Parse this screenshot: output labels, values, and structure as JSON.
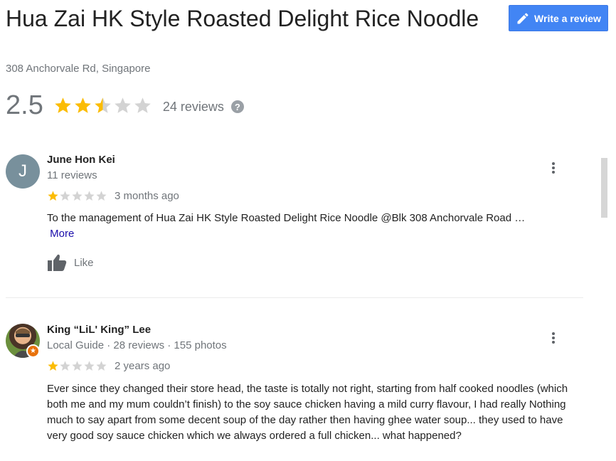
{
  "place": {
    "name": "Hua Zai HK Style Roasted Delight Rice Noodle",
    "address": "308 Anchorvale Rd, Singapore",
    "rating": "2.5",
    "rating_value": 2.5,
    "review_count": "24 reviews",
    "help_icon": "?"
  },
  "actions": {
    "write_review": "Write a review",
    "write_icon": "pencil-icon"
  },
  "colors": {
    "star_filled": "#fbbc04",
    "star_empty": "#d3d3d3",
    "accent": "#4285f4",
    "link": "#1a0dab"
  },
  "reviews": [
    {
      "avatar_letter": "J",
      "author": "June Hon Kei",
      "meta": "11 reviews",
      "stars": 1,
      "time": "3 months ago",
      "text": "To the management of Hua Zai HK Style Roasted Delight Rice Noodle @Blk 308 Anchorvale Road …",
      "more": "More",
      "like": "Like"
    },
    {
      "author": "King “LiL' King” Lee",
      "meta": "Local Guide · 28 reviews · 155 photos",
      "stars": 1,
      "time": "2 years ago",
      "text": "Ever since they changed their store head, the taste is totally not right, starting from half cooked noodles (which both me and my mum couldn’t finish) to the soy sauce chicken having a mild curry flavour, I had really Nothing much to say apart from some decent soup of the day rather then having ghee water soup... they used to have very good soy sauce chicken which we always ordered a full chicken... what happened?"
    }
  ]
}
